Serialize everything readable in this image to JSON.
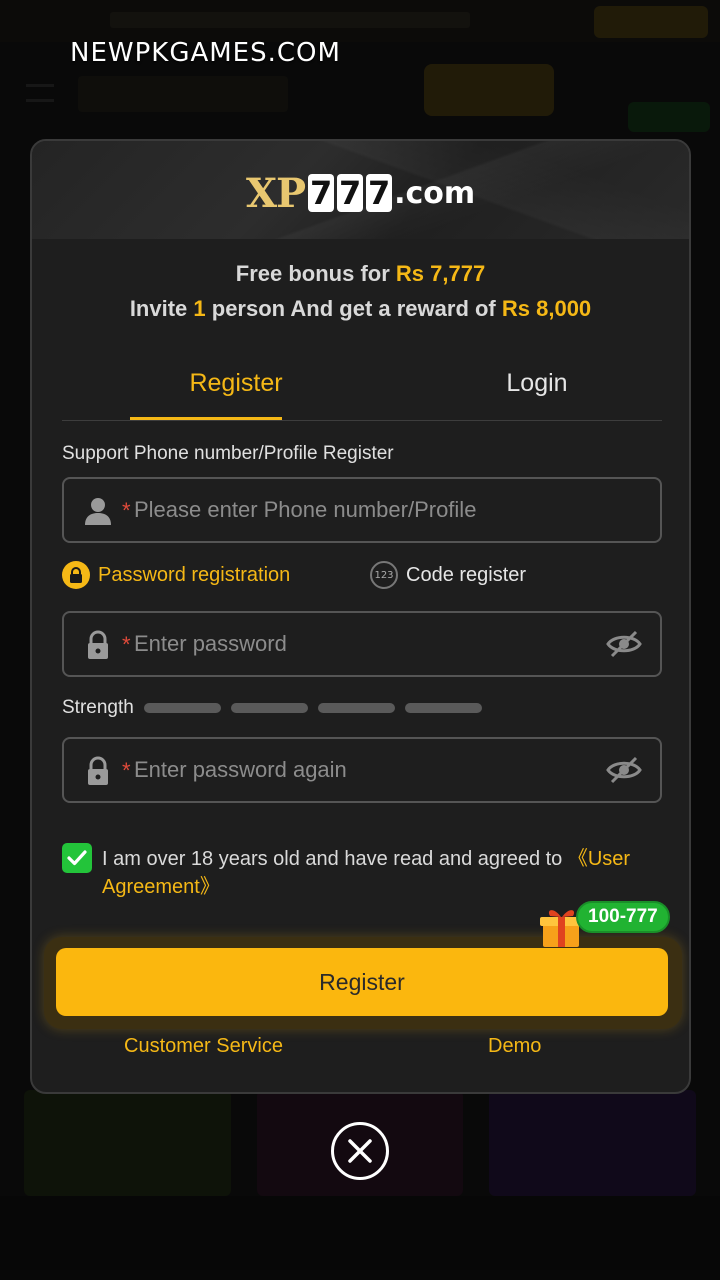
{
  "watermark": "NEWPKGAMES.COM",
  "logo": {
    "prefix": "XP",
    "digits": [
      "7",
      "7",
      "7"
    ],
    "suffix": ".com"
  },
  "bonus": {
    "line1_text": "Free bonus for ",
    "line1_amount": "Rs 7,777",
    "line2_text_a": "Invite ",
    "line2_count": "1",
    "line2_text_b": " person And get a reward of ",
    "line2_amount": "Rs 8,000"
  },
  "tabs": {
    "register": "Register",
    "login": "Login",
    "active": "register"
  },
  "form": {
    "support_label": "Support Phone number/Profile Register",
    "required_mark": "*",
    "phone": {
      "value": "",
      "placeholder": "Please enter Phone number/Profile",
      "icon": "user-icon"
    },
    "options": {
      "password_registration": "Password registration",
      "code_register": "Code register",
      "code_badge": "123",
      "selected": "password_registration"
    },
    "password": {
      "value": "",
      "placeholder": "Enter password",
      "icon": "lock-icon"
    },
    "strength": {
      "label": "Strength",
      "level": 0,
      "segments": 4
    },
    "password_again": {
      "value": "",
      "placeholder": "Enter password again",
      "icon": "lock-icon"
    },
    "agreement": {
      "checked": true,
      "text": "I am over 18 years old and have read and agreed to ",
      "link": "《User Agreement》"
    },
    "submit_label": "Register",
    "gift_badge": "100-777"
  },
  "links": {
    "customer_service": "Customer Service",
    "demo": "Demo"
  },
  "colors": {
    "accent": "#f5b816",
    "button": "#fbb70e",
    "success": "#23c43a",
    "modal_bg": "#1e1e1e"
  }
}
